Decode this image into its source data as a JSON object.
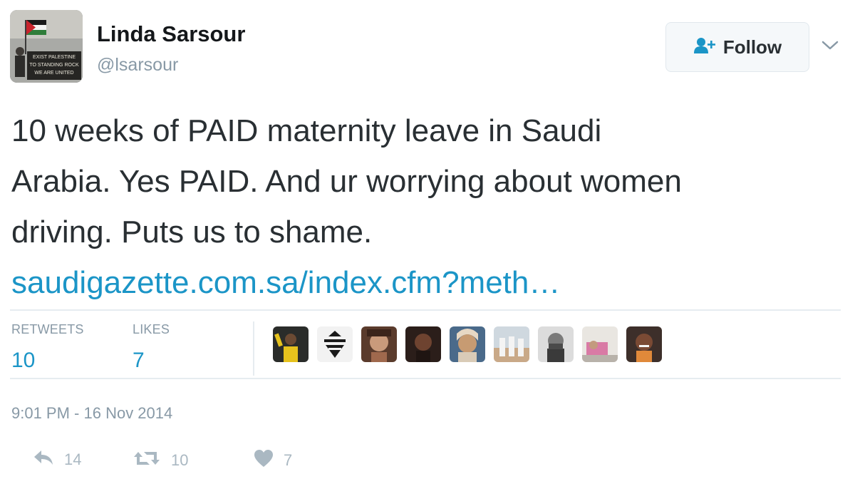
{
  "author": {
    "name": "Linda Sarsour",
    "handle": "@lsarsour",
    "avatar_banner_text": [
      "EXIST PALESTINE",
      "TO STANDING ROCK",
      "WE ARE UNITED"
    ]
  },
  "follow_button": {
    "label": "Follow",
    "icon": "add-user-icon"
  },
  "more_menu_icon": "chevron-down-icon",
  "tweet": {
    "text_lines": [
      "10 weeks of PAID maternity leave in Saudi",
      "Arabia. Yes PAID. And ur worrying about women",
      "driving. Puts us to shame."
    ],
    "link_text": "saudigazette.com.sa/index.cfm?meth…"
  },
  "stats": {
    "retweets_label": "RETWEETS",
    "retweets_value": "10",
    "likes_label": "LIKES",
    "likes_value": "7"
  },
  "likers_count": 9,
  "timestamp": "9:01 PM - 16 Nov 2014",
  "actions": {
    "reply_icon": "reply-icon",
    "reply_count": "14",
    "retweet_icon": "retweet-icon",
    "retweet_count": "10",
    "like_icon": "heart-icon",
    "like_count": "7"
  },
  "colors": {
    "link": "#1b95c7",
    "muted": "#8899a6",
    "text": "#292f33",
    "action_icon": "#aab8c2"
  }
}
